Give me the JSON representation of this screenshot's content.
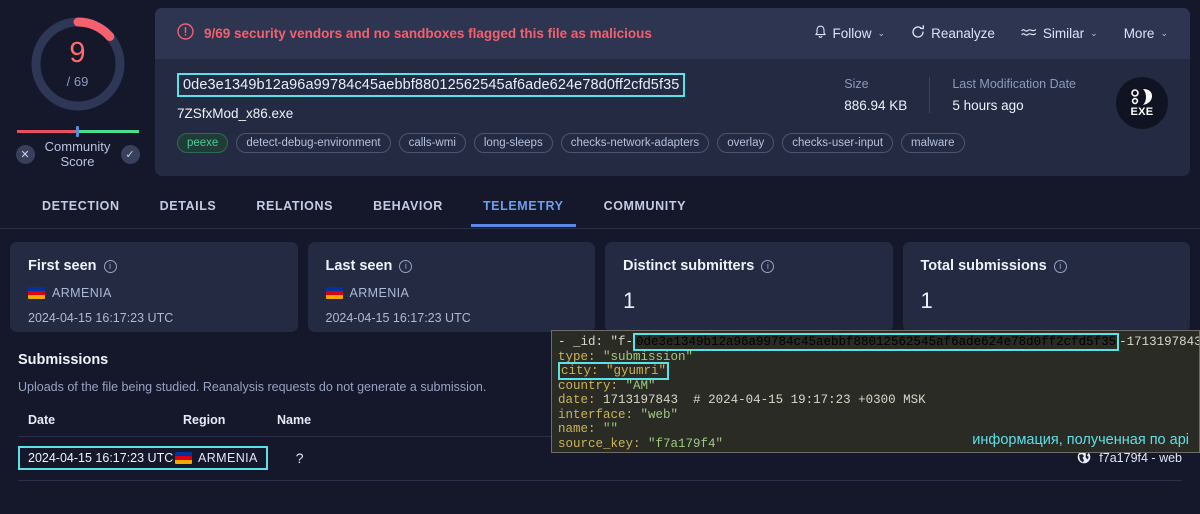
{
  "score": {
    "value": "9",
    "denominator": "/ 69",
    "arc_fraction": 0.13,
    "accent_color": "#ff6b6b",
    "track_color": "#2f3756"
  },
  "community": {
    "label": "Community\nScore",
    "label_line1": "Community",
    "label_line2": "Score",
    "negative_icon": "x-circle-icon",
    "positive_icon": "check-circle-icon"
  },
  "alert": {
    "icon": "exclamation-circle-icon",
    "text": "9/69 security vendors and no sandboxes flagged this file as malicious"
  },
  "actions": [
    {
      "label": "Follow",
      "icon": "bell-icon",
      "caret": "⌄"
    },
    {
      "label": "Reanalyze",
      "icon": "refresh-icon",
      "caret": ""
    },
    {
      "label": "Similar",
      "icon": "waves-icon",
      "caret": "⌄"
    },
    {
      "label": "More",
      "icon": "",
      "caret": "⌄"
    }
  ],
  "file": {
    "hash": "0de3e1349b12a96a99784c45aebbf88012562545af6ade624e78d0ff2cfd5f35",
    "name": "7ZSfxMod_x86.exe",
    "tags": [
      "peexe",
      "detect-debug-environment",
      "calls-wmi",
      "long-sleeps",
      "checks-network-adapters",
      "overlay",
      "checks-user-input",
      "malware"
    ],
    "size_label": "Size",
    "size_value": "886.94 KB",
    "modified_label": "Last Modification Date",
    "modified_value": "5 hours ago",
    "type_badge": "EXE"
  },
  "tabs": [
    {
      "label": "DETECTION",
      "active": false
    },
    {
      "label": "DETAILS",
      "active": false
    },
    {
      "label": "RELATIONS",
      "active": false
    },
    {
      "label": "BEHAVIOR",
      "active": false
    },
    {
      "label": "TELEMETRY",
      "active": true
    },
    {
      "label": "COMMUNITY",
      "active": false
    }
  ],
  "telemetry_cards": [
    {
      "title": "First seen",
      "region": "ARMENIA",
      "date": "2024-04-15 16:17:23 UTC",
      "big": ""
    },
    {
      "title": "Last seen",
      "region": "ARMENIA",
      "date": "2024-04-15 16:17:23 UTC",
      "big": ""
    },
    {
      "title": "Distinct submitters",
      "region": "",
      "date": "",
      "big": "1"
    },
    {
      "title": "Total submissions",
      "region": "",
      "date": "",
      "big": "1"
    }
  ],
  "submissions": {
    "heading": "Submissions",
    "description": "Uploads of the file being studied. Reanalysis requests do not generate a submission.",
    "columns": [
      "Date",
      "Region",
      "Name"
    ],
    "rows": [
      {
        "date": "2024-04-15 16:17:23 UTC",
        "region": "ARMENIA",
        "name": "?",
        "source": "f7a179f4 - web",
        "source_icon": "globe-icon"
      }
    ]
  },
  "json_overlay": {
    "id_prefix": "- _id: \"f-",
    "id_hash": "0de3e1349b12a96a99784c45aebbf88012562545af6ade624e78d0ff2cfd5f35",
    "id_suffix": "-1713197843\"",
    "type_key": "type:",
    "type_value": "\"submission\"",
    "city_line": "city: \"gyumri\"",
    "country_key": "country:",
    "country_value": "\"AM\"",
    "date_key": "date:",
    "date_value": "1713197843",
    "date_comment": "# 2024-04-15 19:17:23 +0300 MSK",
    "interface_key": "interface:",
    "interface_value": "\"web\"",
    "name_key": "name:",
    "name_value": "\"\"",
    "source_key_key": "source_key:",
    "source_key_value": "\"f7a179f4\"",
    "annotation": "информация, полученная по api",
    "annotation_color": "#5ce1e6",
    "highlight_color": "#5ce1e6"
  }
}
